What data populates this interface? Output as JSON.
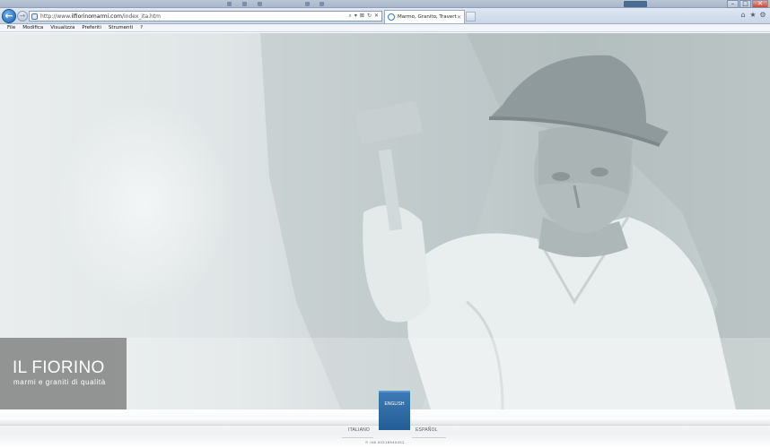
{
  "browser": {
    "url_prefix": "http://www.",
    "url_domain": "ilfiorinomarmi.com",
    "url_path": "/index_ita.htm",
    "tab_title": "Marmo, Granito, Travertino...",
    "address_tools": [
      "⌕",
      "▾",
      "⊠",
      "↻",
      "✕"
    ],
    "right_icons": [
      "⌂",
      "★",
      "⚙"
    ],
    "window_buttons": [
      "–",
      "□",
      "✕"
    ]
  },
  "menu": [
    "File",
    "Modifica",
    "Visualizza",
    "Preferiti",
    "Strumenti",
    "?"
  ],
  "site": {
    "logo_title": "IL FIORINO",
    "logo_subtitle": "marmi e graniti di qualità",
    "languages": {
      "italiano": "ITALIANO",
      "english": "ENGLISH",
      "espanol": "ESPAÑOL"
    },
    "vat": "P. IVA 00518940452"
  },
  "colors": {
    "active_language": "#2b6aa6",
    "logo_box": "#8f9191"
  }
}
